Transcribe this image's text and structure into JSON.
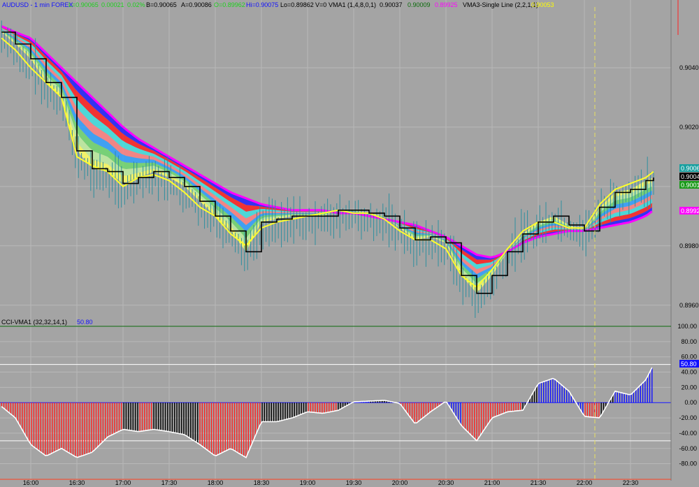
{
  "header": {
    "symbol": "AUDUSD - 1 min  FOREX",
    "last": "L=0.90065",
    "change": "0.00021",
    "change_pct": "0.02%",
    "bid": "B=0.90065",
    "ask": "A=0.90086",
    "open": "O=0.89962",
    "high": "Hi=0.90075",
    "low": "Lo=0.89862",
    "volume": "V=0",
    "vma1_label": "VMA1 (1,4,8,0,1)",
    "vma1_v1": "0.90037",
    "vma1_v2": "0.90009",
    "vma1_v3": "0.89925",
    "vma3_label": "VMA3-Single Line (2,2,1,1)",
    "vma3_v1": "0.90053"
  },
  "indicator_header": {
    "label": "CCI-VMA1 (32,32,14,1)",
    "value": "50.80"
  },
  "price_badges": [
    "0.9006",
    "0.9004",
    "0.9001",
    "0.8992"
  ],
  "cci_badge": "50.80",
  "colors": {
    "background": "#a4a4a4",
    "grid": "#b8b8b8",
    "price_candle": "#2f8f9f",
    "stepline": "#000000",
    "envelope": "#ffff2a",
    "cci_negative": "#ff2020",
    "cci_positive": "#1010ff",
    "cci_neutral": "#000000",
    "cci_line": "#ffffff",
    "session_marker": "#e8e060",
    "ribbon_outer": "#ff00ff",
    "ribbon_bands": [
      "#2020ff",
      "#ff2020",
      "#40e0e0",
      "#ff8080",
      "#30a0ff",
      "#70d870",
      "#c0f0a0",
      "#ffff60"
    ],
    "badges": [
      "#1aa0a0",
      "#000000",
      "#1a9a1a",
      "#ff00ff"
    ],
    "cci_badge_bg": "#1010ff"
  },
  "chart_data": [
    {
      "type": "line",
      "title": "AUDUSD - 1 min FOREX",
      "x_ticks": [
        "16:00",
        "16:30",
        "17:00",
        "17:30",
        "18:00",
        "18:30",
        "19:00",
        "19:30",
        "20:00",
        "20:30",
        "21:00",
        "21:30",
        "22:00",
        "22:30"
      ],
      "y_ticks": [
        "0.9040",
        "0.9020",
        "0.9000",
        "0.8980",
        "0.8960"
      ],
      "ylim": [
        0.8955,
        0.906
      ],
      "x": [
        "15:41",
        "15:50",
        "16:00",
        "16:10",
        "16:20",
        "16:30",
        "16:40",
        "16:50",
        "17:00",
        "17:10",
        "17:20",
        "17:30",
        "17:40",
        "17:50",
        "18:00",
        "18:10",
        "18:20",
        "18:30",
        "18:40",
        "18:50",
        "19:00",
        "19:10",
        "19:20",
        "19:30",
        "19:40",
        "19:50",
        "20:00",
        "20:10",
        "20:20",
        "20:30",
        "20:40",
        "20:50",
        "21:00",
        "21:10",
        "21:20",
        "21:30",
        "21:40",
        "21:50",
        "22:00",
        "22:10",
        "22:20",
        "22:30",
        "22:40",
        "22:45"
      ],
      "series": [
        {
          "name": "VMA1",
          "values": [
            0.9052,
            0.9048,
            0.9043,
            0.9035,
            0.903,
            0.9012,
            0.9006,
            0.9005,
            0.9001,
            0.9003,
            0.9005,
            0.9003,
            0.9,
            0.8995,
            0.899,
            0.8985,
            0.8978,
            0.8988,
            0.8989,
            0.899,
            0.899,
            0.899,
            0.8992,
            0.8992,
            0.8991,
            0.899,
            0.8986,
            0.8982,
            0.8983,
            0.8981,
            0.897,
            0.8964,
            0.897,
            0.8978,
            0.8984,
            0.8988,
            0.899,
            0.8987,
            0.8985,
            0.8993,
            0.8998,
            0.8999,
            0.9002,
            0.9003
          ]
        },
        {
          "name": "VMA3-Single Line",
          "values": [
            0.905,
            0.9046,
            0.904,
            0.9035,
            0.903,
            0.901,
            0.9007,
            0.9005,
            0.9,
            0.9003,
            0.9004,
            0.9002,
            0.8998,
            0.8993,
            0.899,
            0.8984,
            0.898,
            0.8986,
            0.8988,
            0.8989,
            0.899,
            0.8991,
            0.8992,
            0.8991,
            0.8991,
            0.8989,
            0.8985,
            0.8982,
            0.8982,
            0.8979,
            0.897,
            0.8966,
            0.8972,
            0.8979,
            0.8985,
            0.8988,
            0.8988,
            0.8986,
            0.8986,
            0.8994,
            0.8999,
            0.9001,
            0.9003,
            0.9005
          ]
        },
        {
          "name": "VMA1 slow",
          "values": [
            0.9054,
            0.9052,
            0.905,
            0.9045,
            0.904,
            0.9035,
            0.903,
            0.9025,
            0.902,
            0.9016,
            0.9013,
            0.901,
            0.9007,
            0.9004,
            0.9001,
            0.8998,
            0.8996,
            0.8994,
            0.8993,
            0.8992,
            0.8992,
            0.8992,
            0.8991,
            0.8991,
            0.899,
            0.8989,
            0.8988,
            0.8987,
            0.8985,
            0.8983,
            0.898,
            0.8977,
            0.8976,
            0.8978,
            0.8981,
            0.8983,
            0.8984,
            0.8985,
            0.8985,
            0.8986,
            0.8987,
            0.8988,
            0.899,
            0.8992
          ]
        }
      ]
    },
    {
      "type": "bar",
      "title": "CCI-VMA1 (32,32,14,1)",
      "y_ticks": [
        "100.00",
        "80.00",
        "60.00",
        "40.00",
        "20.00",
        "0.00",
        "-20.00",
        "-40.00",
        "-60.00",
        "-80.00"
      ],
      "ylim": [
        -95,
        100
      ],
      "reference_lines": [
        100,
        50,
        0,
        -50
      ],
      "x": [
        "15:41",
        "15:50",
        "16:00",
        "16:10",
        "16:20",
        "16:30",
        "16:40",
        "16:50",
        "17:00",
        "17:10",
        "17:20",
        "17:30",
        "17:40",
        "17:50",
        "18:00",
        "18:10",
        "18:20",
        "18:30",
        "18:40",
        "18:50",
        "19:00",
        "19:10",
        "19:20",
        "19:30",
        "19:40",
        "19:50",
        "20:00",
        "20:10",
        "20:20",
        "20:30",
        "20:40",
        "20:50",
        "21:00",
        "21:10",
        "21:20",
        "21:30",
        "21:40",
        "21:50",
        "22:00",
        "22:10",
        "22:20",
        "22:30",
        "22:40",
        "22:45"
      ],
      "values": [
        -5,
        -20,
        -55,
        -70,
        -60,
        -72,
        -65,
        -45,
        -35,
        -38,
        -35,
        -38,
        -42,
        -55,
        -70,
        -60,
        -72,
        -25,
        -25,
        -20,
        -12,
        -14,
        -10,
        1,
        2,
        3,
        -1,
        -28,
        -12,
        2,
        -30,
        -50,
        -20,
        -12,
        -10,
        25,
        32,
        15,
        -18,
        -20,
        15,
        10,
        30,
        50
      ],
      "colors": [
        "red",
        "red",
        "red",
        "red",
        "red",
        "red",
        "red",
        "red",
        "black",
        "red",
        "black",
        "black",
        "black",
        "red",
        "red",
        "red",
        "red",
        "black",
        "black",
        "black",
        "red",
        "red",
        "black",
        "blue",
        "black",
        "black",
        "red",
        "red",
        "red",
        "blue",
        "red",
        "red",
        "red",
        "red",
        "black",
        "blue",
        "blue",
        "blue",
        "red",
        "black",
        "blue",
        "blue",
        "blue",
        "blue"
      ]
    }
  ]
}
